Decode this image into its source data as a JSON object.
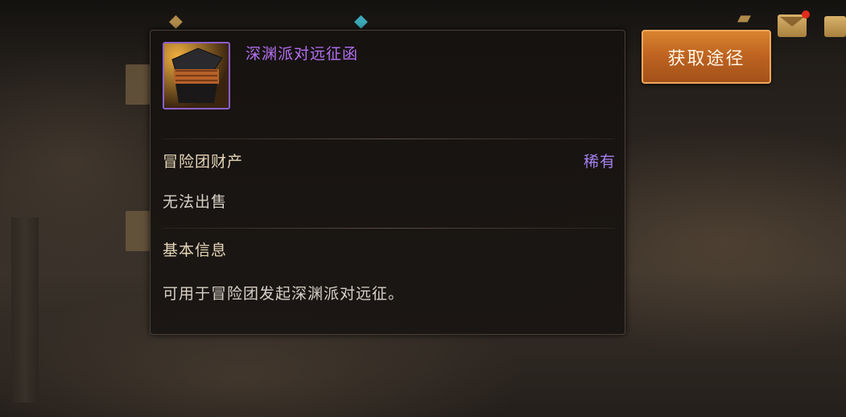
{
  "item": {
    "name": "深渊派对远征函",
    "category": "冒险团财产",
    "rarity": "稀有",
    "sell_status": "无法出售",
    "section_title": "基本信息",
    "description": "可用于冒险团发起深渊派对远征。"
  },
  "actions": {
    "obtain_button": "获取途径"
  },
  "colors": {
    "title_purple": "#b36ff0",
    "rarity_purple": "#a680f0",
    "button_orange": "#c96a24"
  }
}
